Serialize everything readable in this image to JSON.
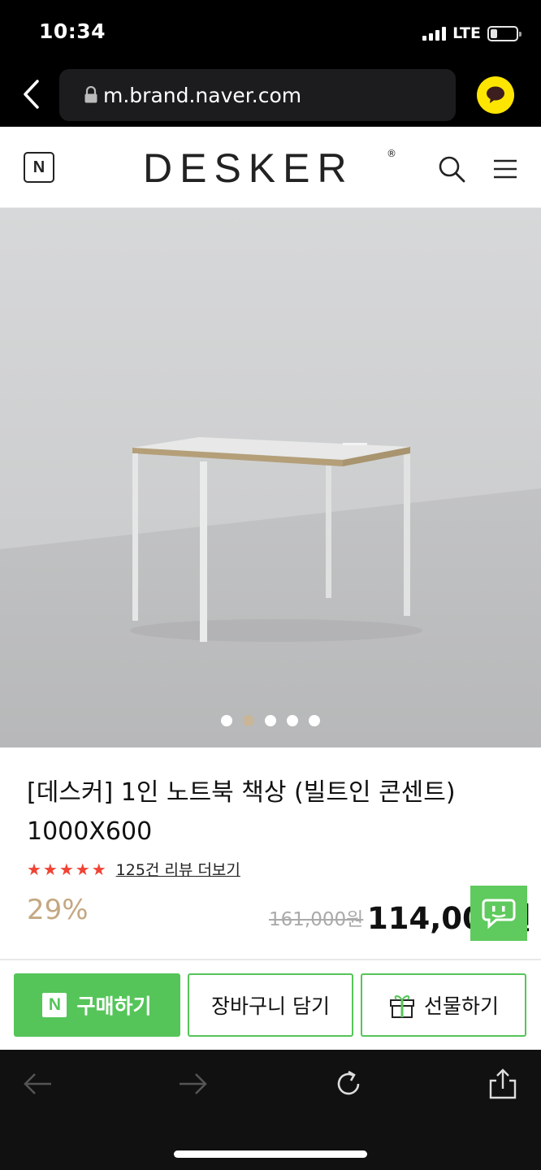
{
  "status_bar": {
    "time": "10:34",
    "network": "LTE"
  },
  "browser": {
    "url": "m.brand.naver.com"
  },
  "header": {
    "platform_logo": "N",
    "brand": "DESKER",
    "brand_mark": "®"
  },
  "gallery": {
    "slide_count": 5,
    "active_index": 1
  },
  "product": {
    "title": "[데스커] 1인 노트북 책상 (빌트인 콘센트) 1000X600",
    "stars": "★★★★★",
    "review_link": "125건 리뷰 더보기",
    "discount": "29%",
    "original_price": "161,000원",
    "sale_price": "114,000원"
  },
  "actions": {
    "buy_icon": "N",
    "buy": "구매하기",
    "cart": "장바구니 담기",
    "gift": "선물하기"
  },
  "colors": {
    "naver_green": "#55c559",
    "star_red": "#f04336",
    "discount_tan": "#c4a882",
    "kakao_yellow": "#fee500"
  }
}
